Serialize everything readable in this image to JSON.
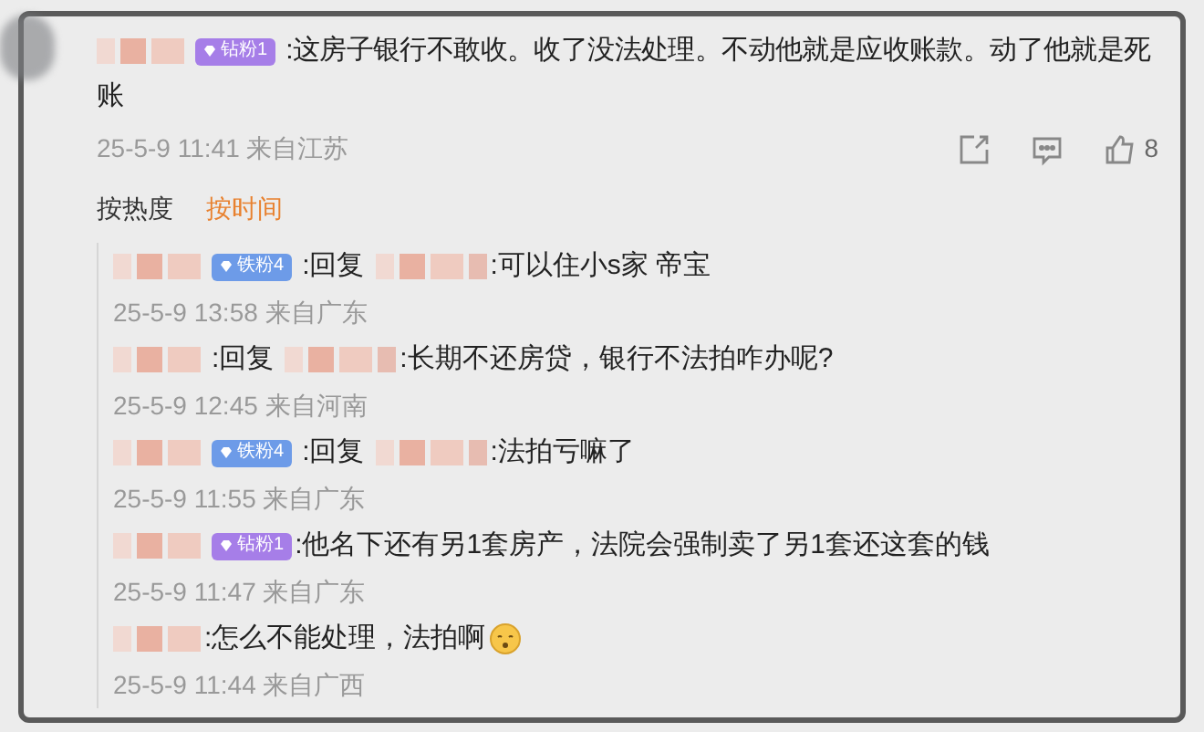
{
  "comment": {
    "badge": {
      "text": "钻粉1",
      "color": "#a67ee8"
    },
    "text_lines": [
      ":这房子银行不敢收。收了没法处理。不动他就是应收账款。动了他就是死",
      "账"
    ],
    "meta": "25-5-9 11:41 来自江苏",
    "likes": "8"
  },
  "sort_tabs": [
    {
      "label": "按热度",
      "selected": false
    },
    {
      "label": "按时间",
      "selected": true
    }
  ],
  "replies": [
    {
      "badge": {
        "text": "铁粉4",
        "color": "#6d9be8"
      },
      "reply_word": ":回复",
      "text": ":可以住小s家 帝宝",
      "emoji": false,
      "meta": "25-5-9 13:58 来自广东"
    },
    {
      "reply_word": ":回复",
      "text": ":长期不还房贷，银行不法拍咋办呢?",
      "emoji": false,
      "meta": "25-5-9 12:45 来自河南"
    },
    {
      "badge": {
        "text": "铁粉4",
        "color": "#6d9be8"
      },
      "reply_word": ":回复",
      "text": ":法拍亏嘛了",
      "emoji": false,
      "meta": "25-5-9 11:55 来自广东"
    },
    {
      "badge": {
        "text": "钻粉1",
        "color": "#a67ee8"
      },
      "text": ":他名下还有另1套房产，法院会强制卖了另1套还这套的钱",
      "emoji": false,
      "meta": "25-5-9 11:47 来自广东"
    },
    {
      "text": ":怎么不能处理，法拍啊",
      "emoji": true,
      "meta": "25-5-9 11:44 来自广西"
    }
  ]
}
